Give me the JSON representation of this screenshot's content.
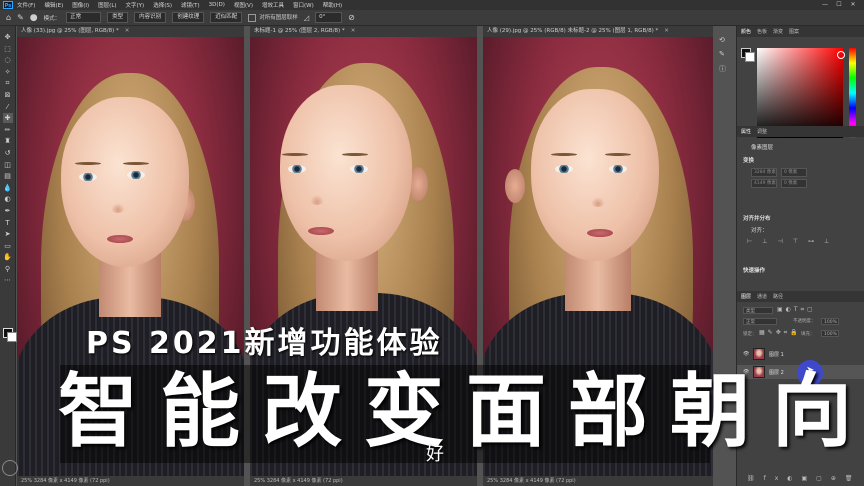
{
  "menubar": {
    "logo": "Ps",
    "items": [
      "文件(F)",
      "编辑(E)",
      "图像(I)",
      "图层(L)",
      "文字(Y)",
      "选择(S)",
      "滤镜(T)",
      "3D(D)",
      "视图(V)",
      "增效工具",
      "窗口(W)",
      "帮助(H)"
    ],
    "controls": [
      "—",
      "☐",
      "✕"
    ]
  },
  "options_bar": {
    "mode_label": "模式：",
    "mode_value": "正常",
    "btn_type": "类型",
    "btn_content_aware": "内容识别",
    "btn_create_texture": "创建纹理",
    "btn_proximity": "近似匹配",
    "sample_all_layers": "对所有图层取样",
    "angle_value": "0°"
  },
  "documents": [
    {
      "tab": "人像 (33).jpg @ 25% (图层, RGB/8) *",
      "status": "25%     3284 像素 x 4149 像素 (72 ppi)"
    },
    {
      "tab": "未标题-1 @ 25% (图层 2, RGB/8) *",
      "status": "25%     3284 像素 x 4149 像素 (72 ppi)"
    },
    {
      "tab": "人像 (29).jpg @ 25% (RGB/8)    未标题-2 @ 25% (图层 1, RGB/8) *",
      "status": "25%     3284 像素 x 4149 像素 (72 ppi)"
    }
  ],
  "panels": {
    "color_tabs": [
      "颜色",
      "色板",
      "渐变",
      "图案"
    ],
    "properties_tabs": [
      "属性",
      "调整"
    ],
    "prop_doc_label": "像素图层",
    "transform_head": "变换",
    "transform_fields": [
      "3284 像素",
      "0 像素",
      "4149 像素",
      "0 像素"
    ],
    "align_head": "对齐并分布",
    "align_label": "对齐：",
    "quick_head": "快速操作",
    "layers_tabs": [
      "图层",
      "通道",
      "路径"
    ],
    "layer_filter": "类型",
    "blend_mode": "正常",
    "opacity_label": "不透明度：",
    "opacity_value": "100%",
    "lock_label": "锁定：",
    "fill_label": "填充：",
    "fill_value": "100%",
    "layers": [
      "图层 1",
      "图层 2"
    ]
  },
  "overlay": {
    "subtitle": "PS 2021新增功能体验",
    "title": "智能改变面部朝向",
    "small": "好"
  }
}
